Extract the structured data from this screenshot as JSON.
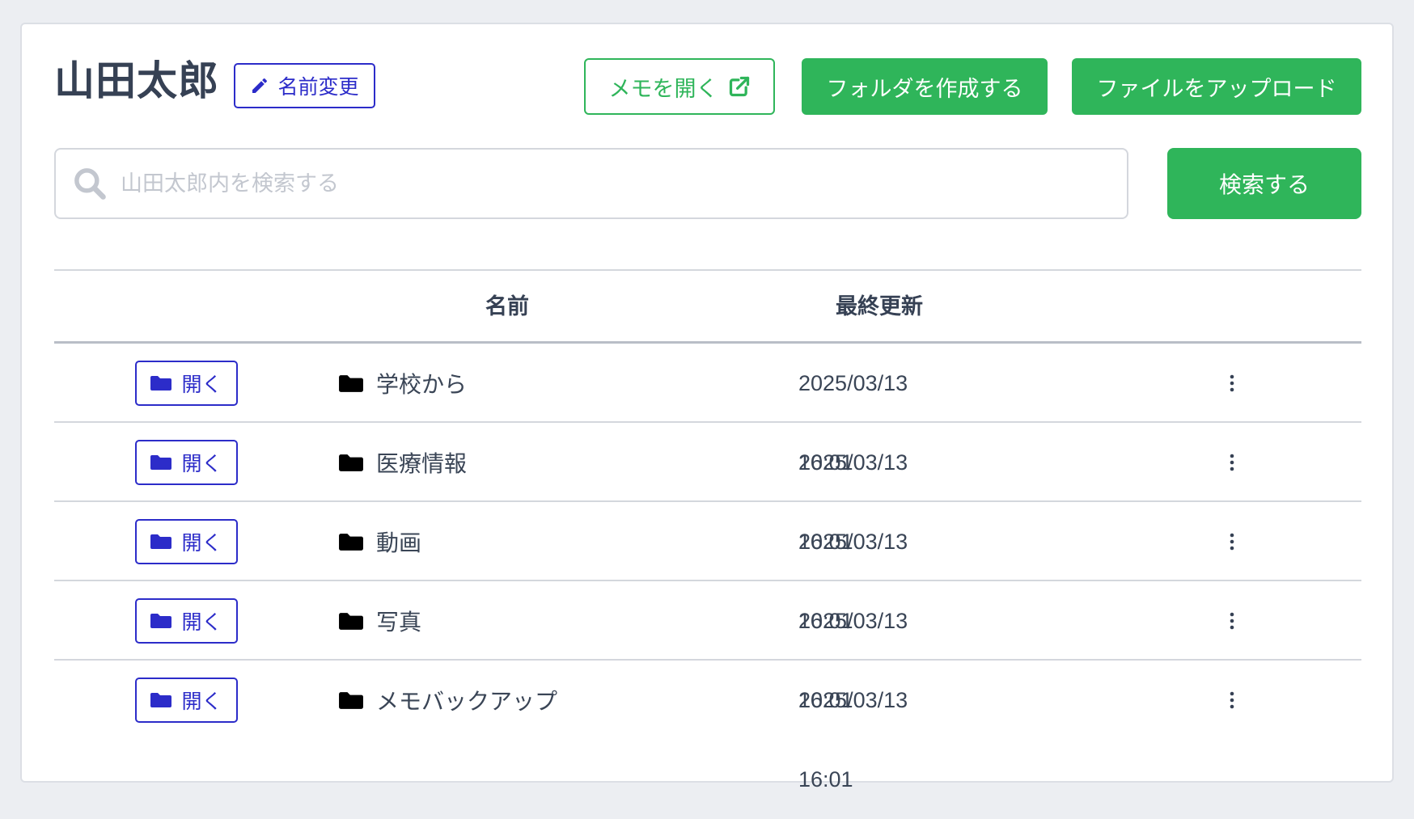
{
  "header": {
    "title": "山田太郎",
    "rename_label": "名前変更",
    "open_memo_label": "メモを開く",
    "create_folder_label": "フォルダを作成する",
    "upload_label": "ファイルをアップロード"
  },
  "search": {
    "placeholder": "山田太郎内を検索する",
    "button_label": "検索する"
  },
  "table": {
    "columns": [
      "名前",
      "最終更新"
    ],
    "open_label": "開く",
    "rows": [
      {
        "name": "学校から",
        "updated": "2025/03/13 16:01"
      },
      {
        "name": "医療情報",
        "updated": "2025/03/13 16:01"
      },
      {
        "name": "動画",
        "updated": "2025/03/13 16:01"
      },
      {
        "name": "写真",
        "updated": "2025/03/13 16:01"
      },
      {
        "name": "メモバックアップ",
        "updated": "2025/03/13 16:01"
      }
    ]
  },
  "colors": {
    "primary_green": "#2fb55a",
    "accent_blue": "#2c2cc9",
    "text_dark": "#364154",
    "background": "#eceef2"
  },
  "icons": {
    "rename": "pencil-icon",
    "open_memo": "external-link-icon",
    "search": "search-icon",
    "open": "folder-icon",
    "row": "folder-icon",
    "row_menu": "vertical-ellipsis-icon"
  }
}
